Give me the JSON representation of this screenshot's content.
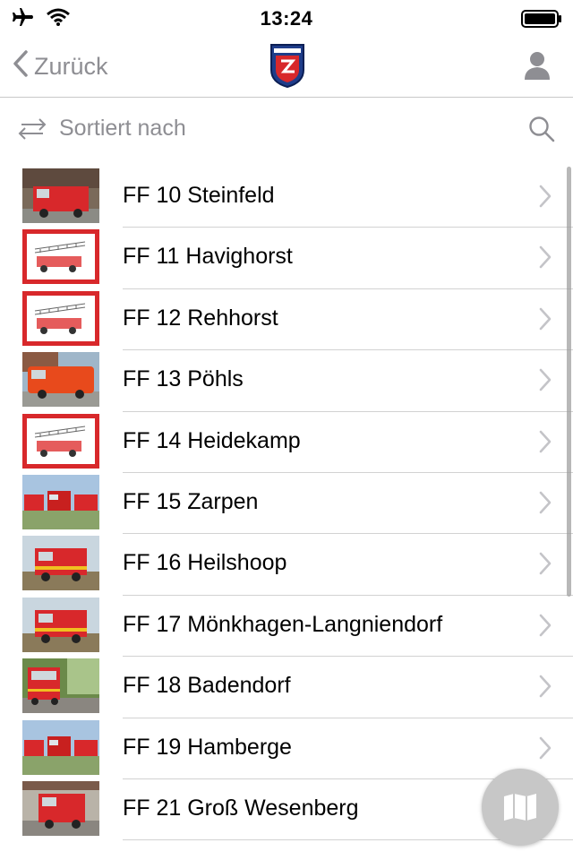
{
  "status_bar": {
    "time": "13:24"
  },
  "nav": {
    "back_label": "Zurück"
  },
  "sort": {
    "label": "Sortiert nach"
  },
  "colors": {
    "accent_gray": "#8e8e93",
    "divider": "#d2d2d2",
    "fire_red": "#d8282b"
  },
  "list": {
    "items": [
      {
        "label": "FF 10 Steinfeld",
        "thumb": "photo-truck"
      },
      {
        "label": "FF 11 Havighorst",
        "thumb": "drawing-ladder"
      },
      {
        "label": "FF 12 Rehhorst",
        "thumb": "drawing-ladder"
      },
      {
        "label": "FF 13 Pöhls",
        "thumb": "photo-van"
      },
      {
        "label": "FF 14 Heidekamp",
        "thumb": "drawing-ladder"
      },
      {
        "label": "FF 15 Zarpen",
        "thumb": "photo-trucks"
      },
      {
        "label": "FF 16 Heilshoop",
        "thumb": "photo-truck-field"
      },
      {
        "label": "FF 17 Mönkhagen-Langniendorf",
        "thumb": "photo-truck-field"
      },
      {
        "label": "FF 18 Badendorf",
        "thumb": "photo-truck-trees"
      },
      {
        "label": "FF 19 Hamberge",
        "thumb": "photo-trucks"
      },
      {
        "label": "FF 21 Groß Wesenberg",
        "thumb": "photo-truck-garage"
      }
    ]
  }
}
